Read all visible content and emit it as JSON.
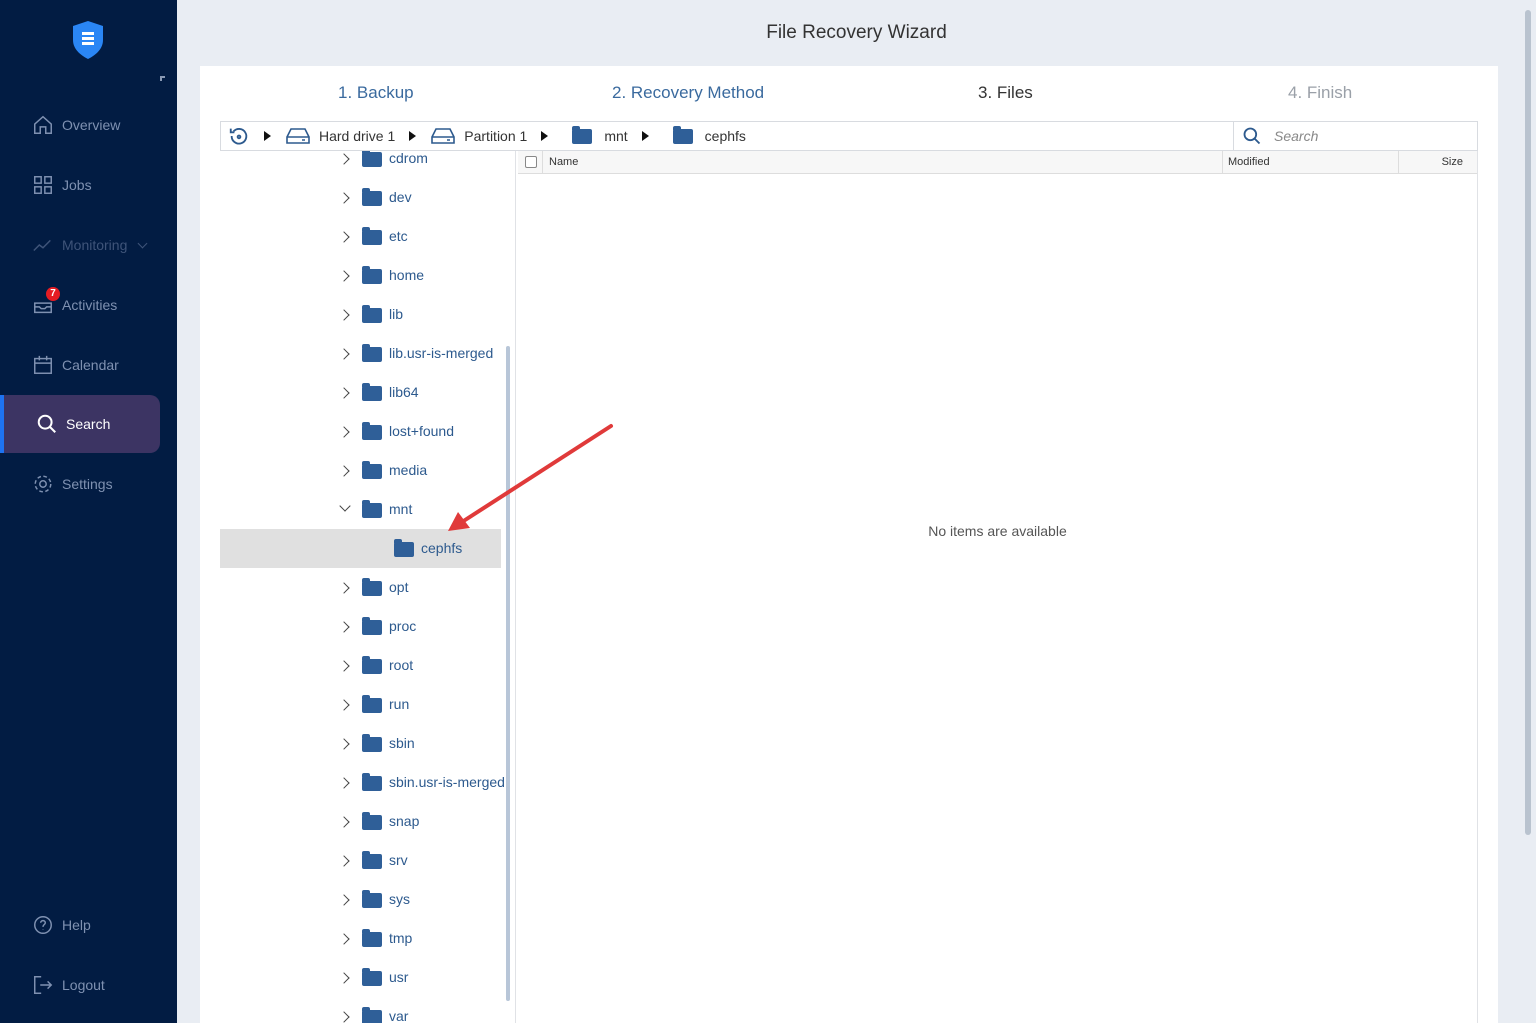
{
  "title": "File Recovery Wizard",
  "sidebar": {
    "items": [
      {
        "label": "Overview"
      },
      {
        "label": "Jobs"
      },
      {
        "label": "Monitoring"
      },
      {
        "label": "Activities",
        "badge": "7"
      },
      {
        "label": "Calendar"
      },
      {
        "label": "Search"
      },
      {
        "label": "Settings"
      },
      {
        "label": "Help"
      },
      {
        "label": "Logout"
      }
    ]
  },
  "steps": [
    "1. Backup",
    "2. Recovery Method",
    "3. Files",
    "4. Finish"
  ],
  "breadcrumb": [
    "Hard drive 1",
    "Partition 1",
    "mnt",
    "cephfs"
  ],
  "search": {
    "placeholder": "Search"
  },
  "tree": [
    "cdrom",
    "dev",
    "etc",
    "home",
    "lib",
    "lib.usr-is-merged",
    "lib64",
    "lost+found",
    "media",
    "mnt",
    "cephfs",
    "opt",
    "proc",
    "root",
    "run",
    "sbin",
    "sbin.usr-is-merged",
    "snap",
    "srv",
    "sys",
    "tmp",
    "usr",
    "var"
  ],
  "table": {
    "columns": [
      "Name",
      "Modified",
      "Size"
    ],
    "empty": "No items are available"
  },
  "colors": {
    "sidebar": "#021c43",
    "accent": "#1e73f0",
    "folder": "#2f5f98",
    "arrow": "#e03a3a"
  }
}
